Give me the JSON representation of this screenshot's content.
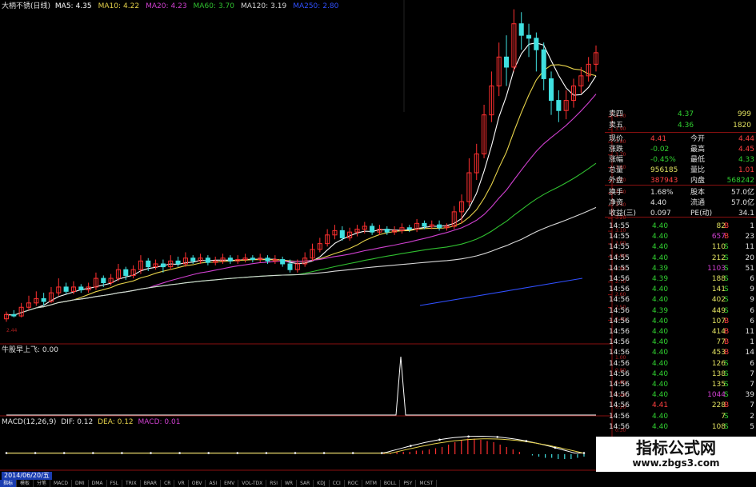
{
  "stock": {
    "name": "大柄不锈(日线)"
  },
  "ma_legend": [
    {
      "label": "MA5:",
      "value": "4.35",
      "color": "#ffffff"
    },
    {
      "label": "MA10:",
      "value": "4.22",
      "color": "#e6d24a"
    },
    {
      "label": "MA20:",
      "value": "4.23",
      "color": "#d040d0"
    },
    {
      "label": "MA60:",
      "value": "3.70",
      "color": "#30c030"
    },
    {
      "label": "MA120:",
      "value": "3.19",
      "color": "#d8d8d8"
    },
    {
      "label": "MA250:",
      "value": "2.80",
      "color": "#3050ff"
    }
  ],
  "price_low_label": "2.44",
  "price_ticks": [
    "4.00",
    "3.90",
    "3.80",
    "3.70",
    "3.60",
    "3.50",
    "3.40",
    "3.30",
    "3.20",
    "3.10",
    "3.00",
    "2.90",
    "2.80",
    "2.70",
    "2.60",
    "2.50",
    "2.40"
  ],
  "signal": {
    "name": "牛股早上飞",
    "value": ": 0.00",
    "ticks": [
      "1.00",
      "0.80",
      "0.60",
      "0.40",
      "0.20"
    ]
  },
  "macd": {
    "label": "MACD(12,26,9)",
    "dif": "DIF: 0.12",
    "dea": "DEA: 0.12",
    "macd": "MACD: 0.01",
    "ticks": [
      "0.30",
      "0.20",
      "0.10"
    ]
  },
  "quote": {
    "ask4": {
      "label": "卖四",
      "price": "4.37",
      "vol": "999"
    },
    "ask5": {
      "label": "卖五",
      "price": "4.36",
      "vol": "1820"
    },
    "stats": [
      {
        "l1": "现价",
        "v1": "4.41",
        "c1": "#ff4040",
        "l2": "今开",
        "v2": "4.44",
        "c2": "#ff4040"
      },
      {
        "l1": "涨跌",
        "v1": "-0.02",
        "c1": "#30d030",
        "l2": "最高",
        "v2": "4.45",
        "c2": "#ff4040"
      },
      {
        "l1": "涨幅",
        "v1": "-0.45%",
        "c1": "#30d030",
        "l2": "最低",
        "v2": "4.33",
        "c2": "#30d030"
      },
      {
        "l1": "总量",
        "v1": "956185",
        "c1": "#e0e060",
        "l2": "量比",
        "v2": "1.01",
        "c2": "#ff4040"
      },
      {
        "l1": "外盘",
        "v1": "387943",
        "c1": "#ff4040",
        "l2": "内盘",
        "v2": "568242",
        "c2": "#30d030"
      },
      {
        "l1": "换手",
        "v1": "1.68%",
        "c1": "#e0e0e0",
        "l2": "股本",
        "v2": "57.0亿",
        "c2": "#e0e0e0"
      },
      {
        "l1": "净资",
        "v1": "4.40",
        "c1": "#e0e0e0",
        "l2": "流通",
        "v2": "57.0亿",
        "c2": "#e0e0e0"
      },
      {
        "l1": "收益(三)",
        "v1": "0.097",
        "c1": "#e0e0e0",
        "l2": "PE(动)",
        "v2": "34.1",
        "c2": "#e0e0e0"
      }
    ],
    "trades": [
      {
        "t": "14:55",
        "p": "4.40",
        "v": "82",
        "s": "B",
        "n": "1"
      },
      {
        "t": "14:55",
        "p": "4.40",
        "v": "657",
        "s": "B",
        "n": "23"
      },
      {
        "t": "14:55",
        "p": "4.40",
        "v": "110",
        "s": "S",
        "n": "11"
      },
      {
        "t": "14:55",
        "p": "4.40",
        "v": "212",
        "s": "S",
        "n": "20"
      },
      {
        "t": "14:55",
        "p": "4.39",
        "v": "1103",
        "s": "S",
        "n": "51"
      },
      {
        "t": "14:56",
        "p": "4.39",
        "v": "188",
        "s": "S",
        "n": "6"
      },
      {
        "t": "14:56",
        "p": "4.40",
        "v": "141",
        "s": "S",
        "n": "9"
      },
      {
        "t": "14:56",
        "p": "4.40",
        "v": "402",
        "s": "S",
        "n": "9"
      },
      {
        "t": "14:56",
        "p": "4.39",
        "v": "449",
        "s": "S",
        "n": "6"
      },
      {
        "t": "14:56",
        "p": "4.40",
        "v": "107",
        "s": "B",
        "n": "6"
      },
      {
        "t": "14:56",
        "p": "4.40",
        "v": "414",
        "s": "B",
        "n": "11"
      },
      {
        "t": "14:56",
        "p": "4.40",
        "v": "77",
        "s": "B",
        "n": "1"
      },
      {
        "t": "14:56",
        "p": "4.40",
        "v": "453",
        "s": "B",
        "n": "14"
      },
      {
        "t": "14:56",
        "p": "4.40",
        "v": "126",
        "s": "S",
        "n": "6"
      },
      {
        "t": "14:56",
        "p": "4.40",
        "v": "138",
        "s": "S",
        "n": "7"
      },
      {
        "t": "14:56",
        "p": "4.40",
        "v": "135",
        "s": "S",
        "n": "7"
      },
      {
        "t": "14:56",
        "p": "4.40",
        "v": "1044",
        "s": "S",
        "n": "39"
      },
      {
        "t": "14:56",
        "p": "4.41",
        "v": "228",
        "s": "B",
        "n": "7"
      },
      {
        "t": "14:56",
        "p": "4.40",
        "v": "7",
        "s": "S",
        "n": "2"
      },
      {
        "t": "14:56",
        "p": "4.40",
        "v": "108",
        "s": "S",
        "n": "5"
      }
    ]
  },
  "bottom": {
    "date": "2014/06/20/五",
    "tabs": [
      "指标",
      "模板",
      "分笔",
      "MACD",
      "DMI",
      "DMA",
      "FSL",
      "TRIX",
      "BRAR",
      "CR",
      "VR",
      "OBV",
      "ASI",
      "EMV",
      "VOL-TDX",
      "RSI",
      "WR",
      "SAR",
      "KDJ",
      "CCI",
      "ROC",
      "MTM",
      "BOLL",
      "PSY",
      "MCST"
    ]
  },
  "watermark": {
    "title": "指标公式网",
    "url": "www.zbgs3.com"
  },
  "chart_data": {
    "type": "candlestick",
    "title": "大柄不锈(日线)",
    "price_range": [
      2.35,
      4.6
    ],
    "candles": [
      [
        2.44,
        2.47,
        2.42,
        2.49
      ],
      [
        2.47,
        2.46,
        2.45,
        2.5
      ],
      [
        2.46,
        2.52,
        2.45,
        2.55
      ],
      [
        2.52,
        2.55,
        2.5,
        2.6
      ],
      [
        2.55,
        2.58,
        2.53,
        2.63
      ],
      [
        2.58,
        2.56,
        2.53,
        2.62
      ],
      [
        2.56,
        2.62,
        2.55,
        2.66
      ],
      [
        2.62,
        2.66,
        2.6,
        2.72
      ],
      [
        2.66,
        2.63,
        2.61,
        2.69
      ],
      [
        2.63,
        2.66,
        2.61,
        2.7
      ],
      [
        2.66,
        2.64,
        2.62,
        2.68
      ],
      [
        2.64,
        2.66,
        2.62,
        2.69
      ],
      [
        2.66,
        2.72,
        2.64,
        2.76
      ],
      [
        2.72,
        2.69,
        2.66,
        2.74
      ],
      [
        2.69,
        2.72,
        2.67,
        2.75
      ],
      [
        2.72,
        2.78,
        2.7,
        2.82
      ],
      [
        2.78,
        2.74,
        2.71,
        2.8
      ],
      [
        2.74,
        2.78,
        2.72,
        2.81
      ],
      [
        2.78,
        2.84,
        2.75,
        2.88
      ],
      [
        2.84,
        2.8,
        2.77,
        2.86
      ],
      [
        2.8,
        2.82,
        2.78,
        2.85
      ],
      [
        2.82,
        2.8,
        2.76,
        2.85
      ],
      [
        2.8,
        2.84,
        2.78,
        2.88
      ],
      [
        2.84,
        2.82,
        2.8,
        2.87
      ],
      [
        2.82,
        2.86,
        2.8,
        2.9
      ],
      [
        2.86,
        2.84,
        2.82,
        2.88
      ],
      [
        2.84,
        2.86,
        2.82,
        2.89
      ],
      [
        2.86,
        2.83,
        2.81,
        2.88
      ],
      [
        2.83,
        2.84,
        2.81,
        2.87
      ],
      [
        2.84,
        2.86,
        2.82,
        2.89
      ],
      [
        2.86,
        2.84,
        2.82,
        2.88
      ],
      [
        2.84,
        2.85,
        2.82,
        2.88
      ],
      [
        2.85,
        2.86,
        2.83,
        2.89
      ],
      [
        2.86,
        2.85,
        2.83,
        2.88
      ],
      [
        2.85,
        2.86,
        2.83,
        2.89
      ],
      [
        2.86,
        2.84,
        2.82,
        2.88
      ],
      [
        2.84,
        2.85,
        2.82,
        2.88
      ],
      [
        2.85,
        2.82,
        2.8,
        2.87
      ],
      [
        2.82,
        2.78,
        2.76,
        2.85
      ],
      [
        2.78,
        2.82,
        2.76,
        2.85
      ],
      [
        2.82,
        2.86,
        2.8,
        2.9
      ],
      [
        2.86,
        2.92,
        2.84,
        2.96
      ],
      [
        2.92,
        2.96,
        2.9,
        3.0
      ],
      [
        2.96,
        3.02,
        2.94,
        3.06
      ],
      [
        3.02,
        3.05,
        2.99,
        3.09
      ],
      [
        3.05,
        3.0,
        2.98,
        3.08
      ],
      [
        3.0,
        3.04,
        2.98,
        3.07
      ],
      [
        3.04,
        3.06,
        3.01,
        3.09
      ],
      [
        3.06,
        3.08,
        3.03,
        3.11
      ],
      [
        3.08,
        3.04,
        3.02,
        3.1
      ],
      [
        3.04,
        3.06,
        3.02,
        3.09
      ],
      [
        3.06,
        3.04,
        3.02,
        3.08
      ],
      [
        3.04,
        3.05,
        3.02,
        3.08
      ],
      [
        3.05,
        3.07,
        3.03,
        3.1
      ],
      [
        3.07,
        3.06,
        3.04,
        3.09
      ],
      [
        3.06,
        3.1,
        3.04,
        3.13
      ],
      [
        3.1,
        3.08,
        3.06,
        3.12
      ],
      [
        3.08,
        3.09,
        3.06,
        3.12
      ],
      [
        3.09,
        3.07,
        3.05,
        3.12
      ],
      [
        3.07,
        3.08,
        3.05,
        3.1
      ],
      [
        3.08,
        3.18,
        3.06,
        3.22
      ],
      [
        3.18,
        3.25,
        3.1,
        3.3
      ],
      [
        3.25,
        3.45,
        3.22,
        3.55
      ],
      [
        3.45,
        3.58,
        3.4,
        3.65
      ],
      [
        3.58,
        3.85,
        3.55,
        3.92
      ],
      [
        3.85,
        4.05,
        3.8,
        4.15
      ],
      [
        4.05,
        4.25,
        3.98,
        4.35
      ],
      [
        4.25,
        4.18,
        4.05,
        4.4
      ],
      [
        4.18,
        4.48,
        4.15,
        4.58
      ],
      [
        4.48,
        4.4,
        4.3,
        4.56
      ],
      [
        4.4,
        4.38,
        4.25,
        4.48
      ],
      [
        4.38,
        4.3,
        4.15,
        4.42
      ],
      [
        4.3,
        4.1,
        4.02,
        4.35
      ],
      [
        4.1,
        3.95,
        3.85,
        4.15
      ],
      [
        3.95,
        3.88,
        3.8,
        4.02
      ],
      [
        3.88,
        3.95,
        3.82,
        4.02
      ],
      [
        3.95,
        4.05,
        3.9,
        4.1
      ],
      [
        4.05,
        4.12,
        4.0,
        4.18
      ],
      [
        4.12,
        4.2,
        4.08,
        4.25
      ],
      [
        4.2,
        4.28,
        4.15,
        4.33
      ]
    ],
    "macd_hist": [
      0.01,
      0.01,
      0.02,
      0.02,
      0.02,
      0.03,
      0.03,
      0.04,
      0.05,
      0.06,
      0.08,
      0.1,
      0.12,
      0.13,
      0.13,
      0.12,
      0.11,
      0.1,
      0.08,
      0.06,
      0.04,
      0.02,
      0.0,
      -0.01,
      -0.02,
      -0.03,
      -0.03,
      -0.04,
      -0.04,
      -0.04,
      -0.03,
      -0.02
    ]
  }
}
